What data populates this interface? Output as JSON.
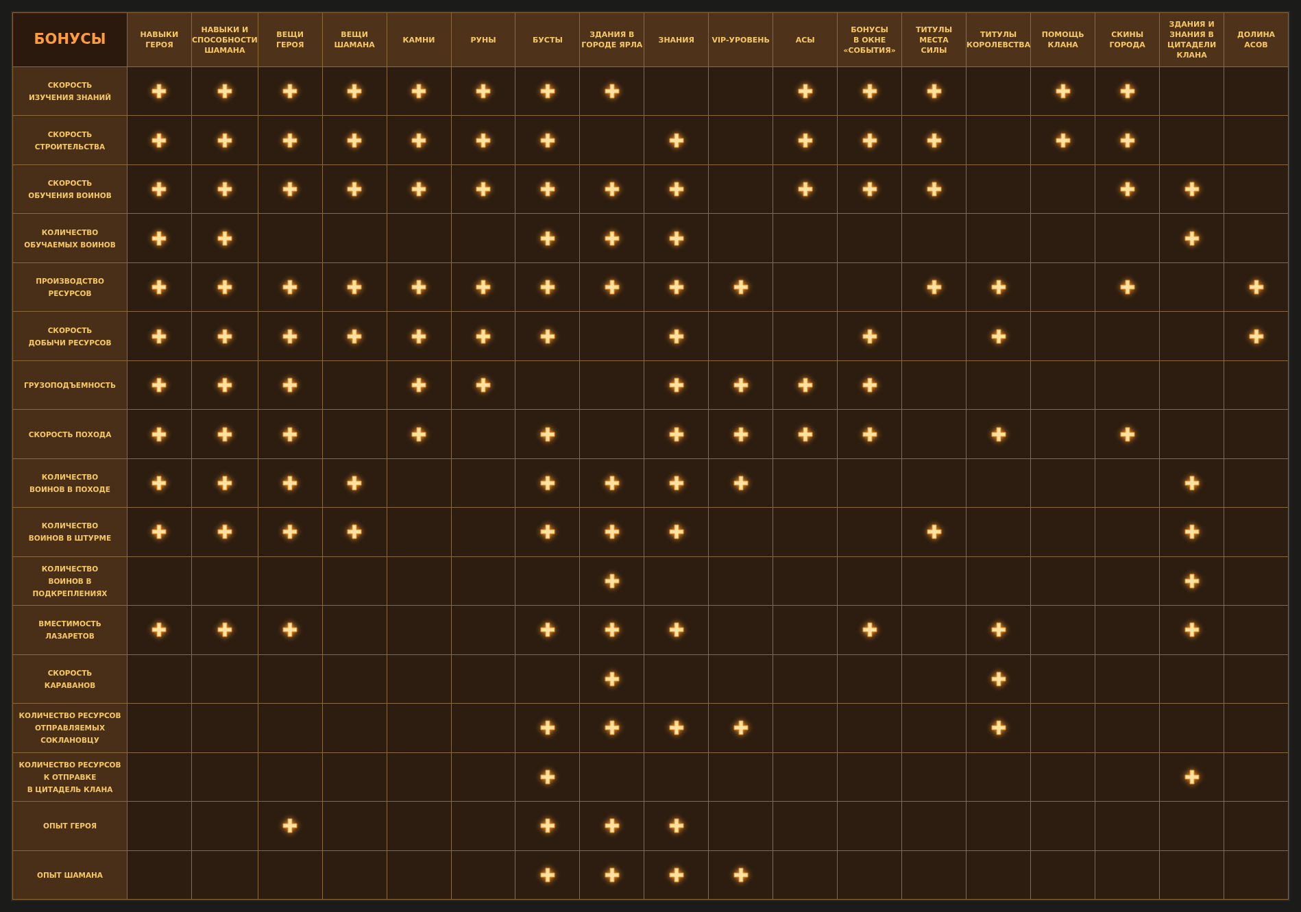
{
  "corner_title": "БОНУСЫ",
  "columns": [
    "НАВЫКИ\nГЕРОЯ",
    "НАВЫКИ И\nСПОСОБНОСТИ\nШАМАНА",
    "ВЕЩИ\nГЕРОЯ",
    "ВЕЩИ\nШАМАНА",
    "КАМНИ",
    "РУНЫ",
    "БУСТЫ",
    "ЗДАНИЯ В\nГОРОДЕ ЯРЛА",
    "ЗНАНИЯ",
    "VIP-УРОВЕНЬ",
    "АСЫ",
    "БОНУСЫ\nВ ОКНЕ\n«СОБЫТИЯ»",
    "ТИТУЛЫ\nМЕСТА\nСИЛЫ",
    "ТИТУЛЫ\nКОРОЛЕВСТВА",
    "ПОМОЩЬ\nКЛАНА",
    "СКИНЫ\nГОРОДА",
    "ЗДАНИЯ И\nЗНАНИЯ В\nЦИТАДЕЛИ\nКЛАНА",
    "ДОЛИНА\nАСОВ"
  ],
  "rows": [
    {
      "label": "СКОРОСТЬ\nИЗУЧЕНИЯ ЗНАНИЙ",
      "cells": [
        true,
        true,
        true,
        true,
        true,
        true,
        true,
        true,
        false,
        false,
        true,
        true,
        true,
        false,
        true,
        true,
        false,
        false
      ]
    },
    {
      "label": "СКОРОСТЬ\nСТРОИТЕЛЬСТВА",
      "cells": [
        true,
        true,
        true,
        true,
        true,
        true,
        true,
        false,
        true,
        false,
        true,
        true,
        true,
        false,
        true,
        true,
        false,
        false
      ]
    },
    {
      "label": "СКОРОСТЬ\nОБУЧЕНИЯ ВОИНОВ",
      "cells": [
        true,
        true,
        true,
        true,
        true,
        true,
        true,
        true,
        true,
        false,
        true,
        true,
        true,
        false,
        false,
        true,
        true,
        false
      ]
    },
    {
      "label": "КОЛИЧЕСТВО\nОБУЧАЕМЫХ ВОИНОВ",
      "cells": [
        true,
        true,
        false,
        false,
        false,
        false,
        true,
        true,
        true,
        false,
        false,
        false,
        false,
        false,
        false,
        false,
        true,
        false
      ]
    },
    {
      "label": "ПРОИЗВОДСТВО\nРЕСУРСОВ",
      "cells": [
        true,
        true,
        true,
        true,
        true,
        true,
        true,
        true,
        true,
        true,
        false,
        false,
        true,
        true,
        false,
        true,
        false,
        true
      ]
    },
    {
      "label": "СКОРОСТЬ\nДОБЫЧИ РЕСУРСОВ",
      "cells": [
        true,
        true,
        true,
        true,
        true,
        true,
        true,
        false,
        true,
        false,
        false,
        true,
        false,
        true,
        false,
        false,
        false,
        true
      ]
    },
    {
      "label": "ГРУЗОПОДЪЕМНОСТЬ",
      "cells": [
        true,
        true,
        true,
        false,
        true,
        true,
        false,
        false,
        true,
        true,
        true,
        true,
        false,
        false,
        false,
        false,
        false,
        false
      ]
    },
    {
      "label": "СКОРОСТЬ ПОХОДА",
      "cells": [
        true,
        true,
        true,
        false,
        true,
        false,
        true,
        false,
        true,
        true,
        true,
        true,
        false,
        true,
        false,
        true,
        false,
        false
      ]
    },
    {
      "label": "КОЛИЧЕСТВО\nВОИНОВ В ПОХОДЕ",
      "cells": [
        true,
        true,
        true,
        true,
        false,
        false,
        true,
        true,
        true,
        true,
        false,
        false,
        false,
        false,
        false,
        false,
        true,
        false
      ]
    },
    {
      "label": "КОЛИЧЕСТВО\nВОИНОВ В ШТУРМЕ",
      "cells": [
        true,
        true,
        true,
        true,
        false,
        false,
        true,
        true,
        true,
        false,
        false,
        false,
        true,
        false,
        false,
        false,
        true,
        false
      ]
    },
    {
      "label": "КОЛИЧЕСТВО\nВОИНОВ В\nПОДКРЕПЛЕНИЯХ",
      "cells": [
        false,
        false,
        false,
        false,
        false,
        false,
        false,
        true,
        false,
        false,
        false,
        false,
        false,
        false,
        false,
        false,
        true,
        false
      ]
    },
    {
      "label": "ВМЕСТИМОСТЬ\nЛАЗАРЕТОВ",
      "cells": [
        true,
        true,
        true,
        false,
        false,
        false,
        true,
        true,
        true,
        false,
        false,
        true,
        false,
        true,
        false,
        false,
        true,
        false
      ]
    },
    {
      "label": "СКОРОСТЬ\nКАРАВАНОВ",
      "cells": [
        false,
        false,
        false,
        false,
        false,
        false,
        false,
        true,
        false,
        false,
        false,
        false,
        false,
        true,
        false,
        false,
        false,
        false
      ]
    },
    {
      "label": "КОЛИЧЕСТВО РЕСУРСОВ\nОТПРАВЛЯЕМЫХ\nСОКЛАНОВЦУ",
      "cells": [
        false,
        false,
        false,
        false,
        false,
        false,
        true,
        true,
        true,
        true,
        false,
        false,
        false,
        true,
        false,
        false,
        false,
        false
      ]
    },
    {
      "label": "КОЛИЧЕСТВО РЕСУРСОВ\nК ОТПРАВКЕ\nВ ЦИТАДЕЛЬ КЛАНА",
      "cells": [
        false,
        false,
        false,
        false,
        false,
        false,
        true,
        false,
        false,
        false,
        false,
        false,
        false,
        false,
        false,
        false,
        true,
        false
      ]
    },
    {
      "label": "ОПЫТ ГЕРОЯ",
      "cells": [
        false,
        false,
        true,
        false,
        false,
        false,
        true,
        true,
        true,
        false,
        false,
        false,
        false,
        false,
        false,
        false,
        false,
        false
      ]
    },
    {
      "label": "ОПЫТ ШАМАНА",
      "cells": [
        false,
        false,
        false,
        false,
        false,
        false,
        true,
        true,
        true,
        true,
        false,
        false,
        false,
        false,
        false,
        false,
        false,
        false
      ]
    }
  ]
}
